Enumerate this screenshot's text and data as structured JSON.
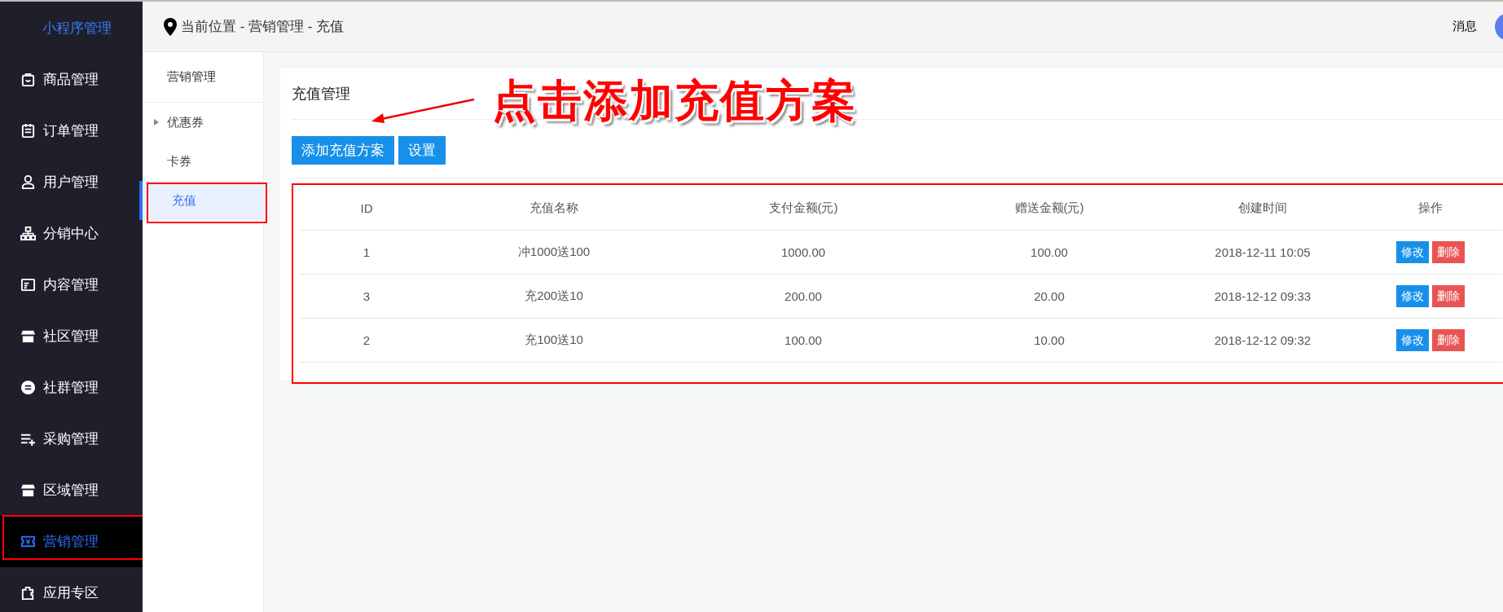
{
  "sidebar": {
    "title": "小程序管理",
    "items": [
      {
        "label": "商品管理",
        "selected": false
      },
      {
        "label": "订单管理",
        "selected": false
      },
      {
        "label": "用户管理",
        "selected": false
      },
      {
        "label": "分销中心",
        "selected": false
      },
      {
        "label": "内容管理",
        "selected": false
      },
      {
        "label": "社区管理",
        "selected": false
      },
      {
        "label": "社群管理",
        "selected": false
      },
      {
        "label": "采购管理",
        "selected": false
      },
      {
        "label": "区域管理",
        "selected": false
      },
      {
        "label": "营销管理",
        "selected": true
      },
      {
        "label": "应用专区",
        "selected": false
      }
    ]
  },
  "header": {
    "breadcrumb": "当前位置 - 营销管理 - 充值",
    "messages": "消息"
  },
  "subnav": {
    "title": "营销管理",
    "items": [
      {
        "label": "优惠券",
        "kind": "group",
        "selected": false
      },
      {
        "label": "卡券",
        "kind": "link",
        "selected": false
      },
      {
        "label": "充值",
        "kind": "link",
        "selected": true
      }
    ]
  },
  "panel": {
    "title": "充值管理",
    "buttons": [
      "添加充值方案",
      "设置"
    ]
  },
  "annotation": "点击添加充值方案",
  "table": {
    "columns": [
      "ID",
      "充值名称",
      "支付金额(元)",
      "赠送金额(元)",
      "创建时间",
      "操作"
    ],
    "rows": [
      {
        "cells": [
          "1",
          "冲1000送100",
          "1000.00",
          "100.00",
          "2018-12-11 10:05"
        ],
        "actions": [
          "修改",
          "删除"
        ]
      },
      {
        "cells": [
          "3",
          "充200送10",
          "200.00",
          "20.00",
          "2018-12-12 09:33"
        ],
        "actions": [
          "修改",
          "删除"
        ]
      },
      {
        "cells": [
          "2",
          "充100送10",
          "100.00",
          "10.00",
          "2018-12-12 09:32"
        ],
        "actions": [
          "修改",
          "删除"
        ]
      }
    ]
  }
}
